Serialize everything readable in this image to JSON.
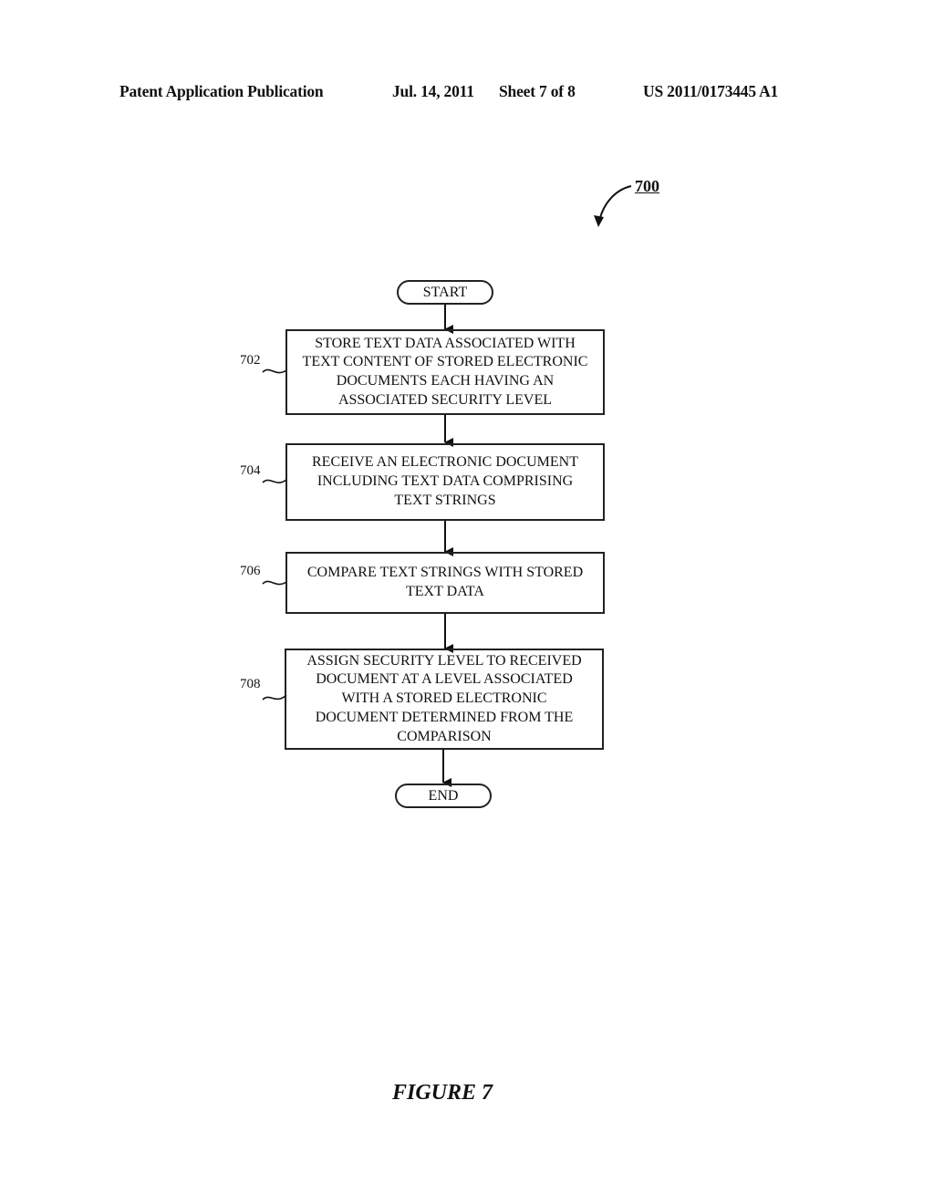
{
  "header": {
    "publication": "Patent Application Publication",
    "date": "Jul. 14, 2011",
    "sheet": "Sheet 7 of 8",
    "number": "US 2011/0173445 A1"
  },
  "figure_ref": "700",
  "flowchart": {
    "start": "START",
    "end": "END",
    "steps": [
      {
        "ref": "702",
        "text": "STORE TEXT DATA ASSOCIATED WITH\nTEXT CONTENT OF STORED ELECTRONIC\nDOCUMENTS EACH HAVING AN\nASSOCIATED SECURITY LEVEL"
      },
      {
        "ref": "704",
        "text": "RECEIVE AN ELECTRONIC DOCUMENT\nINCLUDING TEXT DATA COMPRISING\nTEXT STRINGS"
      },
      {
        "ref": "706",
        "text": "COMPARE TEXT STRINGS WITH STORED\nTEXT DATA"
      },
      {
        "ref": "708",
        "text": "ASSIGN SECURITY LEVEL TO RECEIVED\nDOCUMENT AT A LEVEL ASSOCIATED\nWITH A STORED ELECTRONIC\nDOCUMENT DETERMINED FROM THE\nCOMPARISON"
      }
    ]
  },
  "caption": "FIGURE 7"
}
